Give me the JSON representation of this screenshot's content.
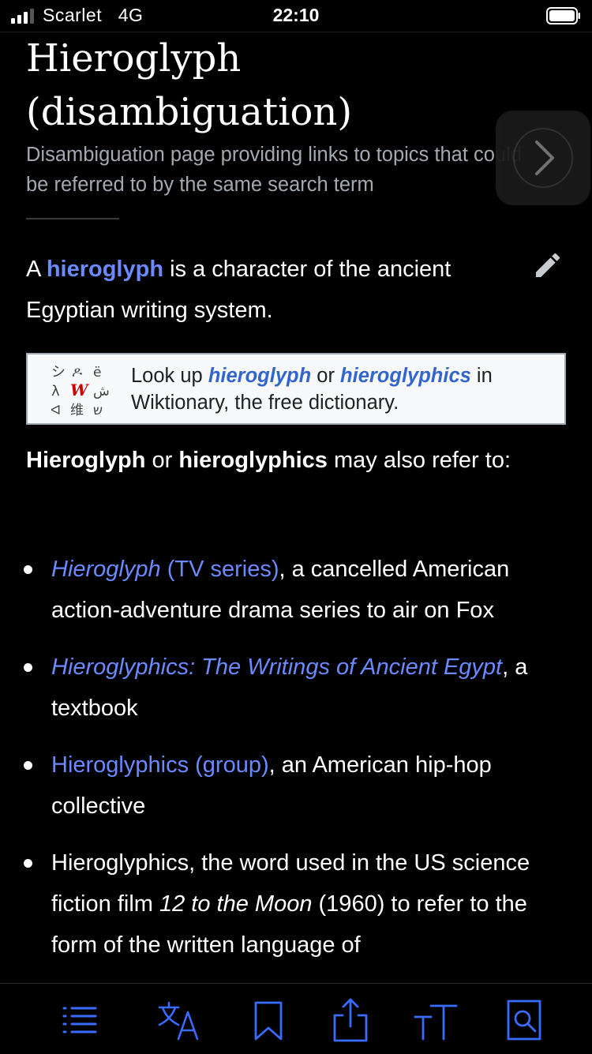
{
  "status": {
    "carrier": "Scarlet",
    "network": "4G",
    "time": "22:10"
  },
  "article": {
    "title": "Hieroglyph (disambiguation)",
    "description": "Disambiguation page providing links to topics that could be referred to by the same search term",
    "intro": {
      "pre": "A ",
      "link": "hieroglyph",
      "post": " is a character of the ancient Egyptian writing system."
    },
    "wiktionary": {
      "pre": "Look up ",
      "term1": "hieroglyph",
      "or": " or ",
      "term2": "hieroglyphics",
      "post": " in Wiktionary, the free dictionary."
    },
    "refer": {
      "term1": "Hieroglyph",
      "or": " or ",
      "term2": "hieroglyphics",
      "post": " may also refer to:"
    },
    "items": [
      {
        "link_italic": "Hieroglyph",
        "link_rest": " (TV series)",
        "text": ", a cancelled American action-adventure drama series to air on Fox"
      },
      {
        "link_italic": "Hieroglyphics: The Writings of Ancient Egypt",
        "text": ", a textbook"
      },
      {
        "link": "Hieroglyphics (group)",
        "text": ", an American hip-hop collective"
      },
      {
        "text_pre": "Hieroglyphics, the word used in the US science fiction film ",
        "italic": "12 to the Moon",
        "text_post": " (1960) to refer to the form of the written language of"
      }
    ]
  },
  "colors": {
    "background": "#000000",
    "link": "#6b8aff",
    "toolbar_icon": "#3a6bff",
    "subtitle": "#a2a9b1"
  },
  "toolbar": {
    "icons": [
      "table-of-contents-icon",
      "language-icon",
      "bookmark-icon",
      "share-icon",
      "text-size-icon",
      "find-in-page-icon"
    ]
  }
}
